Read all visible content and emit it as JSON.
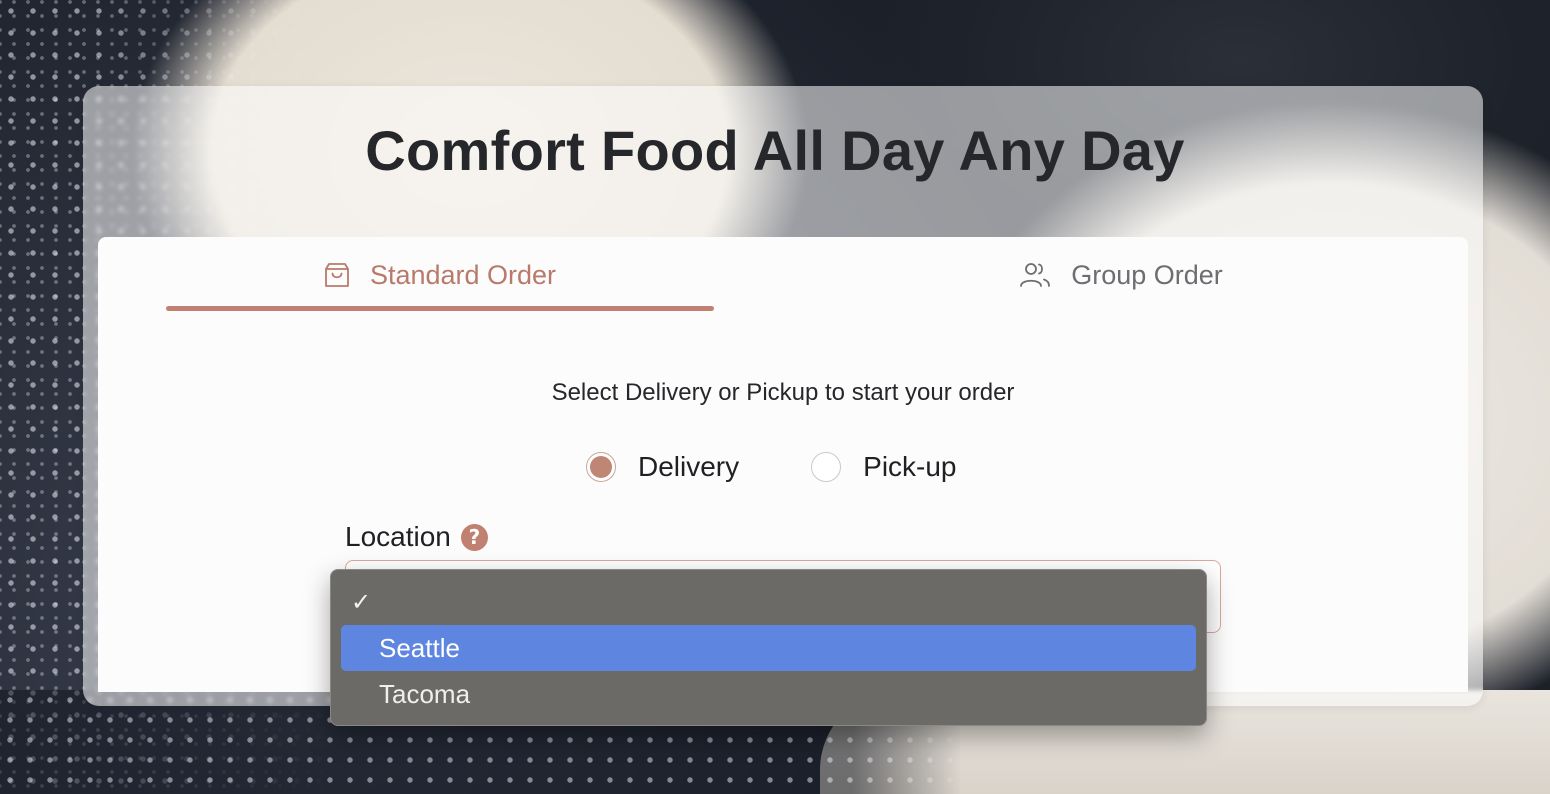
{
  "hero": {
    "title": "Comfort Food All Day Any Day"
  },
  "tabs": [
    {
      "label": "Standard Order",
      "icon": "shopping-bag-icon",
      "active": true
    },
    {
      "label": "Group Order",
      "icon": "users-icon",
      "active": false
    }
  ],
  "order": {
    "prompt": "Select Delivery or Pickup to start your order",
    "methods": [
      {
        "label": "Delivery",
        "checked": true
      },
      {
        "label": "Pick-up",
        "checked": false
      }
    ],
    "location_label": "Location",
    "location_help": "?",
    "location_value": ""
  },
  "location_dropdown": {
    "options": [
      {
        "label": "",
        "checked": true,
        "highlighted": false
      },
      {
        "label": "Seattle",
        "checked": false,
        "highlighted": true
      },
      {
        "label": "Tacoma",
        "checked": false,
        "highlighted": false
      }
    ],
    "check_glyph": "✓"
  },
  "colors": {
    "accent": "#c08172",
    "highlight": "#5e86e0"
  }
}
